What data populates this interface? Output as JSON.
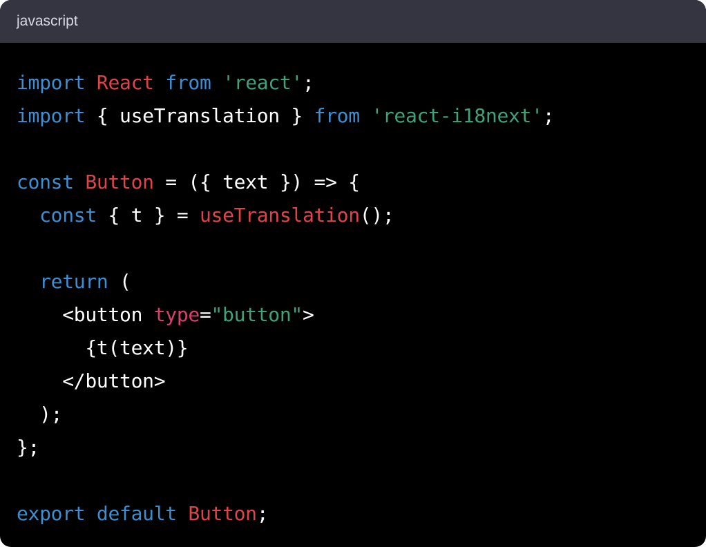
{
  "header": {
    "language": "javascript"
  },
  "colors": {
    "keyword": "#3d8fd1",
    "identifier": "#e0444b",
    "string": "#3fa37a",
    "attribute": "#d8406f",
    "plain": "#ffffff"
  },
  "lines": [
    [
      [
        "kw",
        "import"
      ],
      [
        "pl",
        " "
      ],
      [
        "fn",
        "React"
      ],
      [
        "pl",
        " "
      ],
      [
        "kw",
        "from"
      ],
      [
        "pl",
        " "
      ],
      [
        "str",
        "'react'"
      ],
      [
        "pl",
        ";"
      ]
    ],
    [
      [
        "kw",
        "import"
      ],
      [
        "pl",
        " { useTranslation } "
      ],
      [
        "kw",
        "from"
      ],
      [
        "pl",
        " "
      ],
      [
        "str",
        "'react-i18next'"
      ],
      [
        "pl",
        ";"
      ]
    ],
    [],
    [
      [
        "kw",
        "const"
      ],
      [
        "pl",
        " "
      ],
      [
        "fn",
        "Button"
      ],
      [
        "pl",
        " = ({ text }) => {"
      ]
    ],
    [
      [
        "pl",
        "  "
      ],
      [
        "kw",
        "const"
      ],
      [
        "pl",
        " { t } = "
      ],
      [
        "fn",
        "useTranslation"
      ],
      [
        "pl",
        "();"
      ]
    ],
    [],
    [
      [
        "pl",
        "  "
      ],
      [
        "kw",
        "return"
      ],
      [
        "pl",
        " ("
      ]
    ],
    [
      [
        "pl",
        "    <button "
      ],
      [
        "attr",
        "type"
      ],
      [
        "pl",
        "="
      ],
      [
        "str",
        "\"button\""
      ],
      [
        "pl",
        ">"
      ]
    ],
    [
      [
        "pl",
        "      {t(text)}"
      ]
    ],
    [
      [
        "pl",
        "    </button>"
      ]
    ],
    [
      [
        "pl",
        "  );"
      ]
    ],
    [
      [
        "pl",
        "};"
      ]
    ],
    [],
    [
      [
        "kw",
        "export"
      ],
      [
        "pl",
        " "
      ],
      [
        "kw",
        "default"
      ],
      [
        "pl",
        " "
      ],
      [
        "fn",
        "Button"
      ],
      [
        "pl",
        ";"
      ]
    ]
  ]
}
